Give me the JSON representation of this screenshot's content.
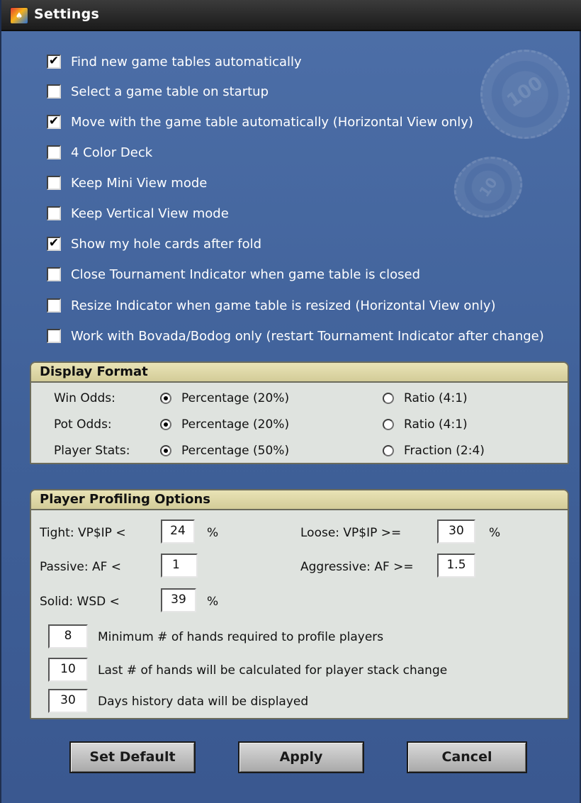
{
  "window": {
    "title": "Settings",
    "icon": "app-logo-icon"
  },
  "checkboxes": [
    {
      "label": "Find new game tables automatically",
      "checked": true
    },
    {
      "label": "Select a game table on startup",
      "checked": false
    },
    {
      "label": "Move with the game table automatically (Horizontal View only)",
      "checked": true
    },
    {
      "label": "4 Color Deck",
      "checked": false
    },
    {
      "label": "Keep Mini View mode",
      "checked": false
    },
    {
      "label": "Keep Vertical View mode",
      "checked": false
    },
    {
      "label": "Show my hole cards after fold",
      "checked": true
    },
    {
      "label": "Close Tournament Indicator when game table is closed",
      "checked": false
    },
    {
      "label": "Resize Indicator when game table is resized (Horizontal View only)",
      "checked": false
    },
    {
      "label": "Work with Bovada/Bodog only (restart Tournament Indicator after change)",
      "checked": false
    }
  ],
  "display_format": {
    "title": "Display Format",
    "rows": [
      {
        "label": "Win Odds:",
        "option1": "Percentage (20%)",
        "option2": "Ratio (4:1)",
        "selected": 1
      },
      {
        "label": "Pot Odds:",
        "option1": "Percentage (20%)",
        "option2": "Ratio (4:1)",
        "selected": 1
      },
      {
        "label": "Player Stats:",
        "option1": "Percentage (50%)",
        "option2": "Fraction (2:4)",
        "selected": 1
      }
    ]
  },
  "profiling": {
    "title": "Player Profiling Options",
    "tight_label": "Tight:  VP$IP <",
    "tight_value": "24",
    "loose_label": "Loose:   VP$IP >=",
    "loose_value": "30",
    "passive_label": "Passive:   AF <",
    "passive_value": "1",
    "aggressive_label": "Aggressive:  AF >=",
    "aggressive_value": "1.5",
    "solid_label": "Solid:  WSD <",
    "solid_value": "39",
    "percent_sign": "%",
    "min_hands_value": "8",
    "min_hands_label": "Minimum # of hands required to profile players",
    "last_hands_value": "10",
    "last_hands_label": "Last # of hands will be calculated for player stack change",
    "days_value": "30",
    "days_label": "Days history data will be displayed"
  },
  "buttons": {
    "set_default": "Set Default",
    "apply": "Apply",
    "cancel": "Cancel"
  },
  "decor": {
    "chip_large_text": "100",
    "chip_small_text": "10"
  }
}
